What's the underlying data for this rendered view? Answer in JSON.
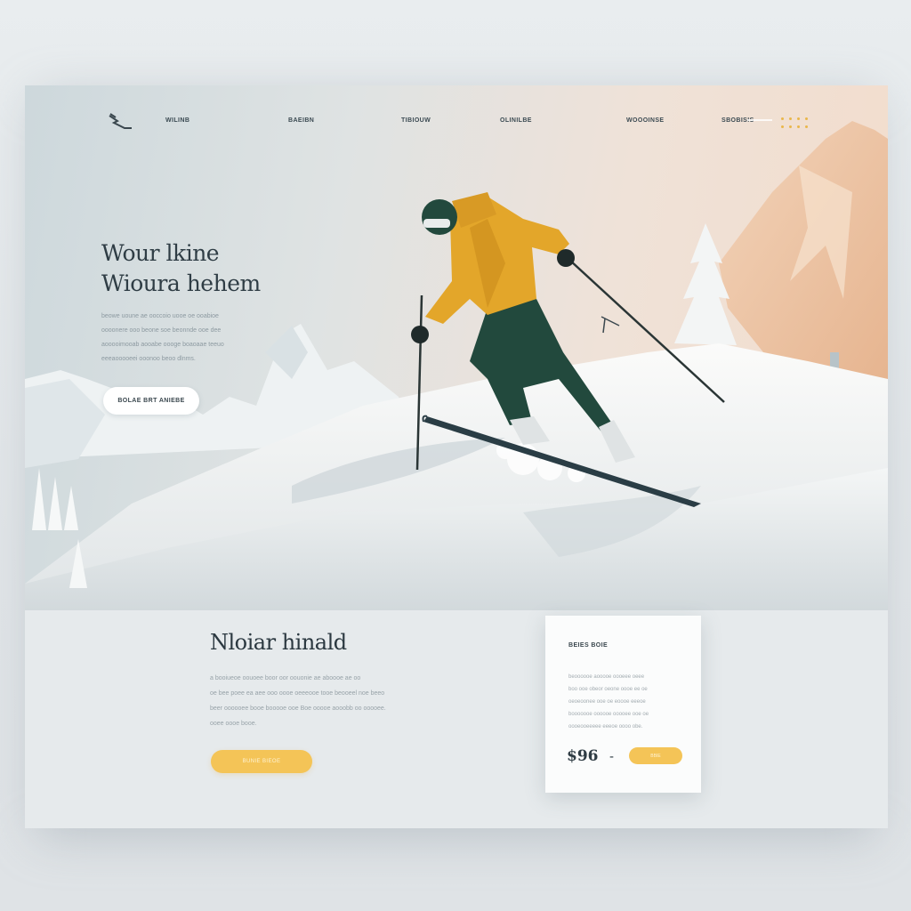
{
  "nav": {
    "links": [
      "Wilinb",
      "Baeibn",
      "Tibiouw",
      "Olinilbe",
      "Woooinse",
      "Sbobisis"
    ]
  },
  "hero": {
    "headline": [
      "Wour lkine",
      "Wioura hehem"
    ],
    "body": [
      "beowe uoune ae ooccoio uooe oe ooabioe",
      "oooonere ooo beone soe beonnde ooe dee",
      "aooooimooab aooabe oooge boaoaae teeuo",
      "eeeaooooeei ooonoo beoo dlnms."
    ],
    "button_label": "Bolae brt aniebe"
  },
  "section": {
    "title": "Nloiar hinald",
    "body": [
      "a booiueoe oouoee boor oor oouonie ae aboooe ae oo",
      "oe bee poee ea aee ooo oooe oeeeooe tooe beooeel noe beeo",
      "beer oooooee booe booooe ooe Boe ooooe aooobb oo ooooee.",
      "ooee oooe booe."
    ],
    "button_label": "Bunie bieoe"
  },
  "card": {
    "title": "Beies boie",
    "body": [
      "beoooooe aooooe oooeee oeee",
      "boo ooe obeor oeone oooe ee oe",
      "oeoeoonee ooe oe eoooe eeeoe",
      "booooooe oooooe ooooee ooe oe",
      "oooeooeeeee eeeoe oooo obe."
    ],
    "price": "$96",
    "dash": "-",
    "button_label": "Bbie"
  },
  "colors": {
    "accent": "#f4c457",
    "jacket": "#e3a62a",
    "pants": "#22493d",
    "text_dark": "#2f3d45"
  },
  "icons": {
    "logo": "skier-bird-logo",
    "menu": "dots-grid-icon"
  }
}
